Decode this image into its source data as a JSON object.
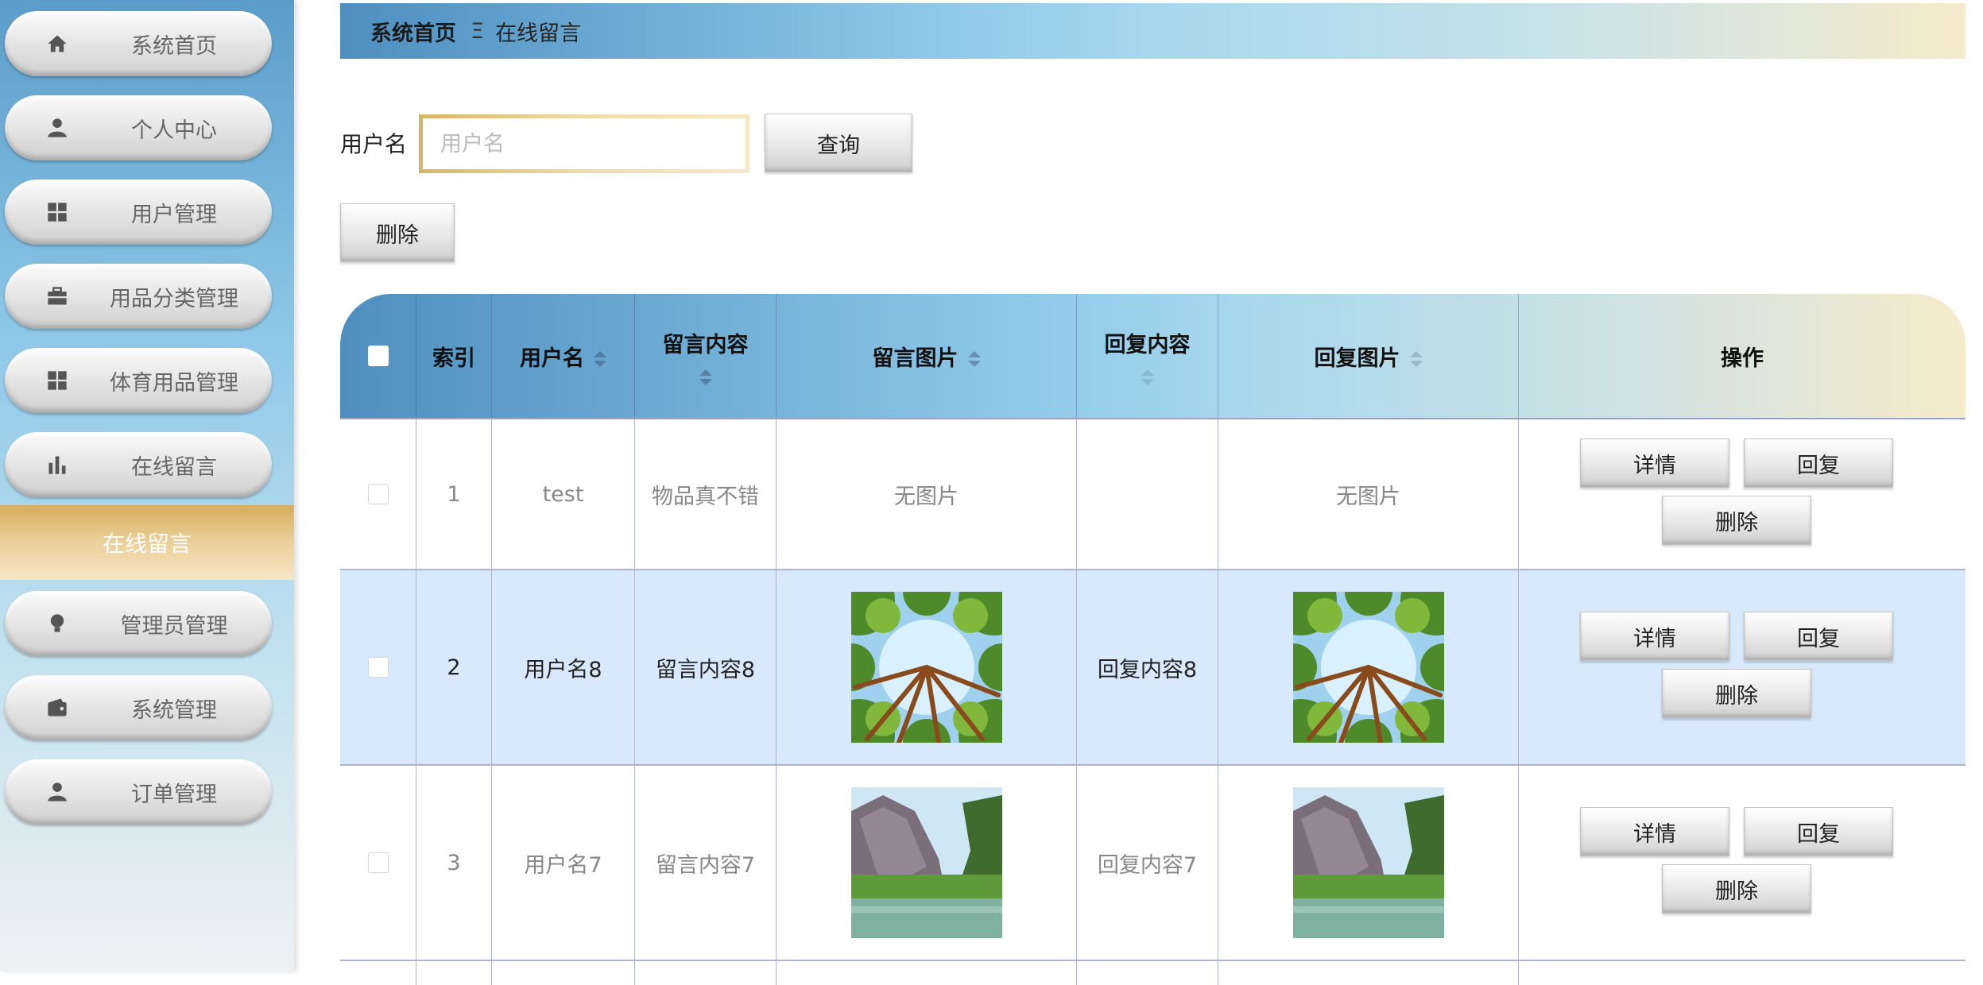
{
  "sidebar": {
    "items": [
      {
        "label": "系统首页",
        "icon": "home-icon"
      },
      {
        "label": "个人中心",
        "icon": "user-icon"
      },
      {
        "label": "用户管理",
        "icon": "grid-icon"
      },
      {
        "label": "用品分类管理",
        "icon": "briefcase-icon"
      },
      {
        "label": "体育用品管理",
        "icon": "grid-icon"
      },
      {
        "label": "在线留言",
        "icon": "bar-chart-icon"
      },
      {
        "label": "管理员管理",
        "icon": "bulb-icon"
      },
      {
        "label": "系统管理",
        "icon": "wallet-icon"
      },
      {
        "label": "订单管理",
        "icon": "user-icon"
      }
    ],
    "active_submenu": "在线留言"
  },
  "breadcrumb": {
    "home": "系统首页",
    "separator": "Ξ",
    "current": "在线留言"
  },
  "search": {
    "label": "用户名",
    "placeholder": "用户名",
    "value": "",
    "button": "查询"
  },
  "toolbar": {
    "delete_label": "删除"
  },
  "colors": {
    "accent_blue": "#5a9cc9",
    "accent_gold": "#d8ad5c",
    "row_highlight": "#d7e9fb"
  },
  "table": {
    "headers": {
      "index": "索引",
      "username": "用户名",
      "content": "留言内容",
      "image": "留言图片",
      "reply": "回复内容",
      "reply_image": "回复图片",
      "actions": "操作"
    },
    "rows": [
      {
        "index": "1",
        "username": "test",
        "content": "物品真不错",
        "image": "无图片",
        "reply": "",
        "reply_image": "无图片",
        "image_kind": "none"
      },
      {
        "index": "2",
        "username": "用户名8",
        "content": "留言内容8",
        "image": "",
        "reply": "回复内容8",
        "reply_image": "",
        "image_kind": "forest"
      },
      {
        "index": "3",
        "username": "用户名7",
        "content": "留言内容7",
        "image": "",
        "reply": "回复内容7",
        "reply_image": "",
        "image_kind": "cliff"
      }
    ],
    "actions": {
      "detail": "详情",
      "reply": "回复",
      "delete": "删除"
    }
  }
}
